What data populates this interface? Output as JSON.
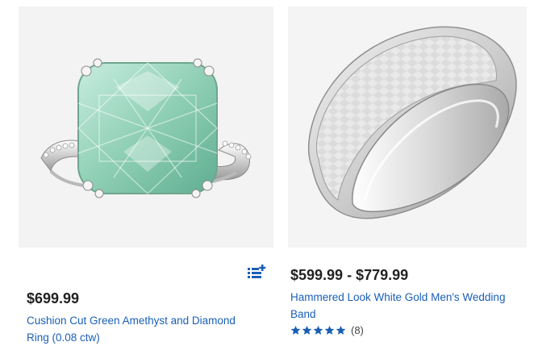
{
  "colors": {
    "link": "#1a5fb4",
    "price": "#222222",
    "star": "#1a5fb4",
    "compare_icon": "#1a5fb4",
    "image_bg": "#f3f3f3"
  },
  "products": [
    {
      "price": "$699.99",
      "title": "Cushion Cut Green Amethyst and Diamond Ring (0.08 ctw)",
      "image_icon": "green-amethyst-ring-image"
    },
    {
      "price": "$599.99 - $779.99",
      "title": "Hammered Look White Gold Men's Wedding Band",
      "image_icon": "wedding-band-image",
      "rating": {
        "stars": 5,
        "count": "(8)"
      }
    }
  ],
  "compare_icon": "compare-list-add-icon"
}
